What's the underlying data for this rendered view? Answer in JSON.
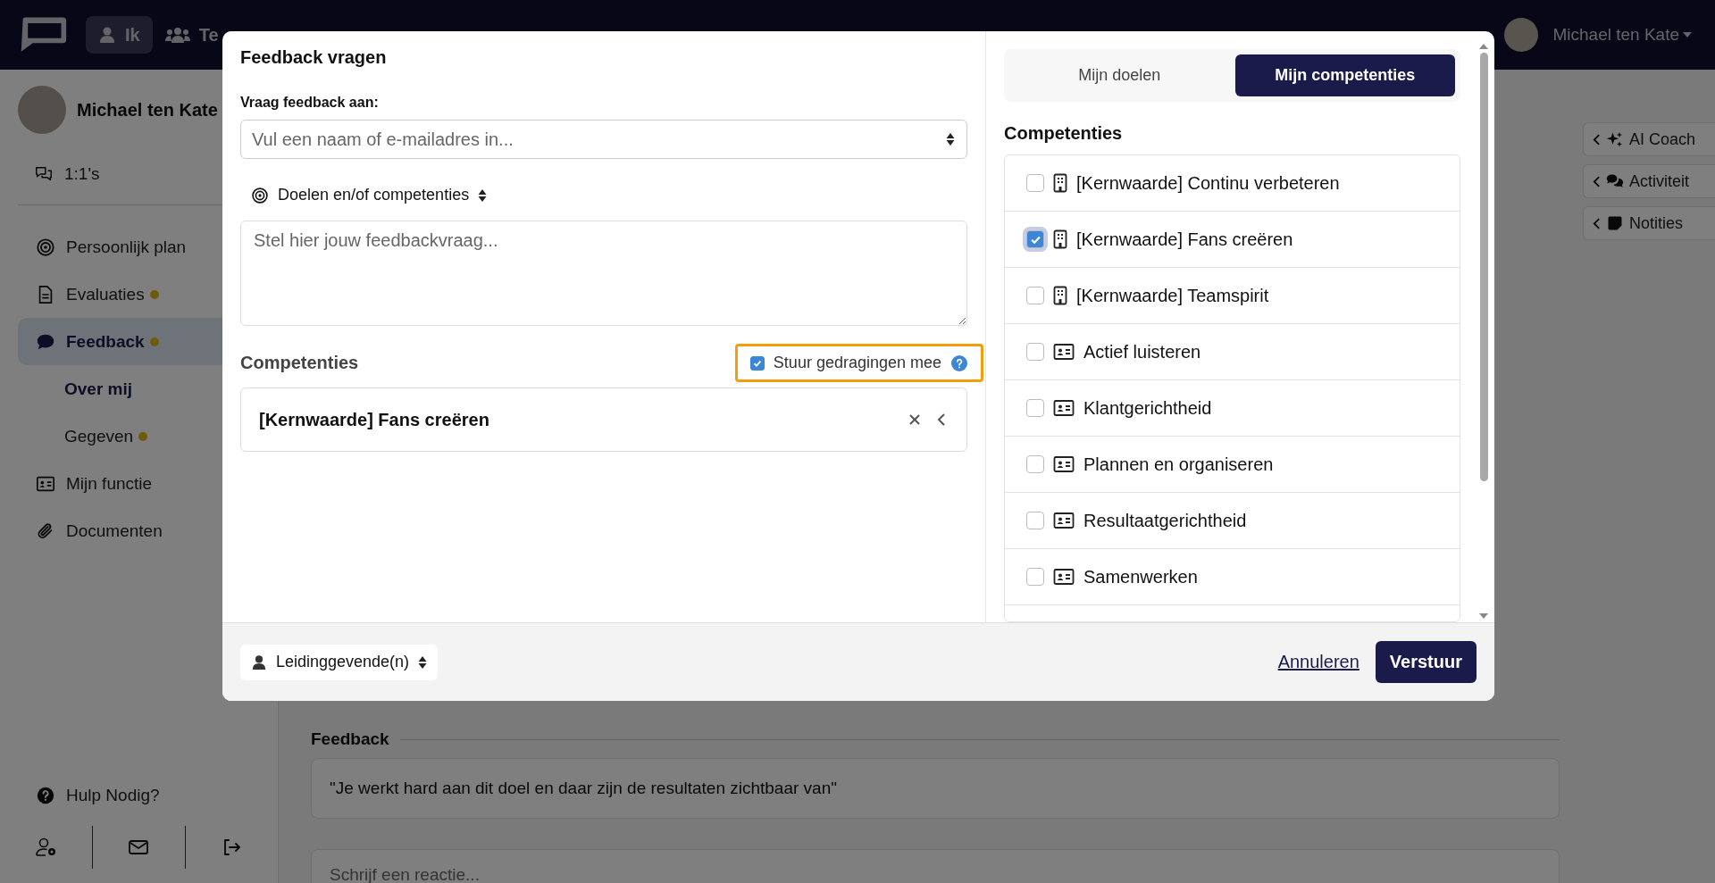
{
  "topbar": {
    "nav": [
      {
        "label": "Ik",
        "kind": "person",
        "selected": true
      },
      {
        "label": "Te",
        "kind": "people",
        "selected": false
      }
    ],
    "user": "Michael ten Kate"
  },
  "sidebar": {
    "user": "Michael ten Kate",
    "meetings": "1:1's",
    "items": [
      {
        "label": "Persoonlijk plan",
        "kind": "target",
        "dot": false,
        "selected": false
      },
      {
        "label": "Evaluaties",
        "kind": "document",
        "dot": true,
        "selected": false
      },
      {
        "label": "Feedback",
        "kind": "chat",
        "dot": true,
        "selected": true,
        "children": [
          {
            "label": "Over mij",
            "dot": false,
            "selected": true
          },
          {
            "label": "Gegeven",
            "dot": true,
            "selected": false
          }
        ]
      },
      {
        "label": "Mijn functie",
        "kind": "idcard",
        "dot": false,
        "selected": false
      },
      {
        "label": "Documenten",
        "kind": "paperclip",
        "dot": false,
        "selected": false
      }
    ],
    "help": "Hulp Nodig?"
  },
  "main": {
    "feedback_heading": "Feedback",
    "quote": "\"Je werkt hard aan dit doel en daar zijn de resultaten zichtbaar van\"",
    "reaction_placeholder": "Schrijf een reactie..."
  },
  "side_panels": [
    {
      "label": "AI Coach",
      "kind": "sparkle"
    },
    {
      "label": "Activiteit",
      "kind": "comments"
    },
    {
      "label": "Notities",
      "kind": "note"
    }
  ],
  "modal": {
    "title": "Feedback vragen",
    "recipient_label": "Vraag feedback aan:",
    "recipient_placeholder": "Vul een naam of e-mailadres in...",
    "type_select": "Doelen en/of competenties",
    "question_placeholder": "Stel hier jouw feedbackvraag...",
    "selected_heading": "Competenties",
    "send_behaviours": {
      "label": "Stuur gedragingen mee",
      "checked": true
    },
    "selected_items": [
      {
        "label": "[Kernwaarde] Fans creëren"
      }
    ],
    "tabs": [
      {
        "label": "Mijn doelen",
        "selected": false
      },
      {
        "label": "Mijn competenties",
        "selected": true
      }
    ],
    "list_heading": "Competenties",
    "competencies": [
      {
        "label": "[Kernwaarde] Continu verbeteren",
        "kind": "core",
        "checked": false
      },
      {
        "label": "[Kernwaarde] Fans creëren",
        "kind": "core",
        "checked": true
      },
      {
        "label": "[Kernwaarde] Teamspirit",
        "kind": "core",
        "checked": false
      },
      {
        "label": "Actief luisteren",
        "kind": "role",
        "checked": false
      },
      {
        "label": "Klantgerichtheid",
        "kind": "role",
        "checked": false
      },
      {
        "label": "Plannen en organiseren",
        "kind": "role",
        "checked": false
      },
      {
        "label": "Resultaatgerichtheid",
        "kind": "role",
        "checked": false
      },
      {
        "label": "Samenwerken",
        "kind": "role",
        "checked": false
      }
    ],
    "audience": "Leidinggevende(n)",
    "cancel": "Annuleren",
    "submit": "Verstuur"
  }
}
